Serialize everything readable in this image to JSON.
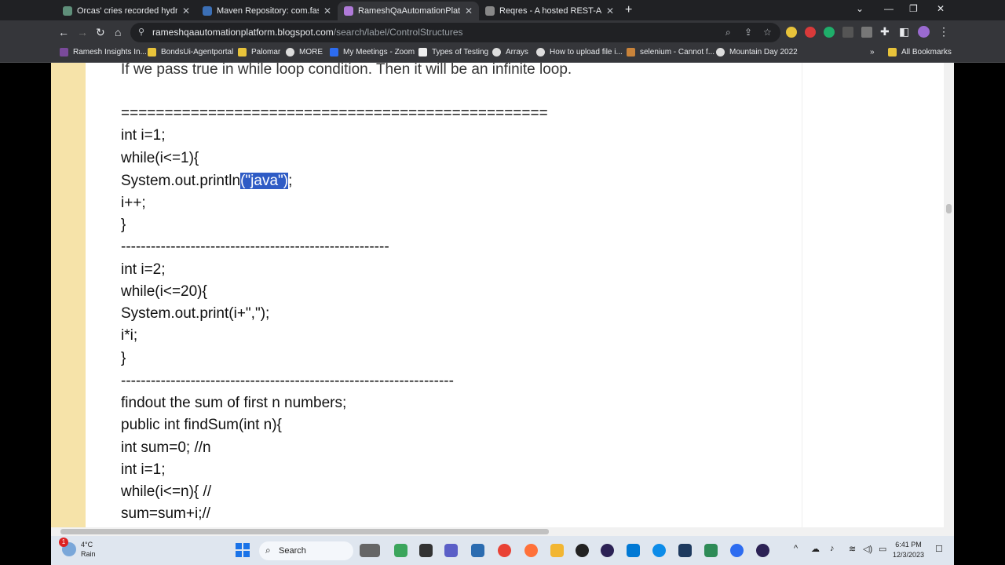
{
  "browser": {
    "tabs": [
      {
        "title": "Orcas' cries recorded hydrophon",
        "active": false
      },
      {
        "title": "Maven Repository: com.fasterxm",
        "active": false
      },
      {
        "title": "RameshQaAutomationPlatform",
        "active": true
      },
      {
        "title": "Reqres - A hosted REST-API rea",
        "active": false
      }
    ],
    "url_host": "rameshqaautomationplatform.blogspot.com",
    "url_path": "/search/label/ControlStructures",
    "bookmarks": [
      "Ramesh Insights In...",
      "BondsUi-Agentportal",
      "Palomar",
      "MORE",
      "My Meetings - Zoom",
      "Types of Testing",
      "Arrays",
      "How to upload file i...",
      "selenium - Cannot f...",
      "Mountain Day 2022"
    ],
    "more_bookmarks": "»",
    "all_bookmarks": "All Bookmarks"
  },
  "content": {
    "lines": [
      "If we pass true in while loop condition. Then it will be an infinite loop.",
      "=================================================",
      "int i=1;",
      "while(i<=1){",
      "System.out.println",
      "(\"java\")",
      ";",
      "i++;",
      "}",
      "------------------------------------------------------",
      "int i=2;",
      "while(i<=20){",
      "System.out.print(i+\",\");",
      "i*i;",
      "}",
      "-------------------------------------------------------------------",
      "findout the sum of first n numbers;",
      "public int findSum(int n){",
      "int sum=0; //n",
      "int i=1;",
      "while(i<=n){ //",
      " sum=sum+i;//"
    ]
  },
  "taskbar": {
    "weather_temp": "4°C",
    "weather_desc": "Rain",
    "weather_badge": "1",
    "search_label": "Search",
    "time": "6:41 PM",
    "date": "12/3/2023"
  },
  "colors": {
    "tab_bg": "#202124",
    "toolbar_bg": "#35363a",
    "selection": "#2f5cc5",
    "sidebar_yellow": "#f6e3a9",
    "taskbar_bg": "#dfe6ef"
  }
}
